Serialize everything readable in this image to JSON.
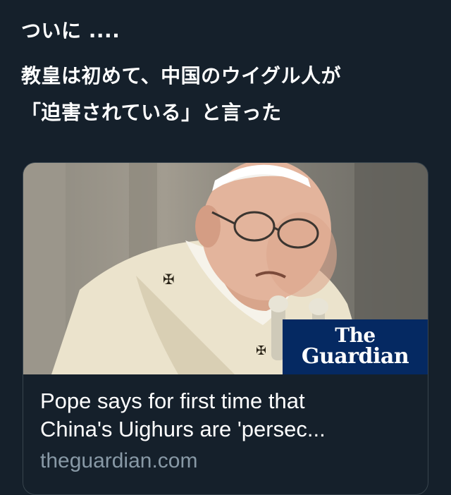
{
  "tweet": {
    "line1": "ついに ....",
    "line2": "教皇は初めて、中国のウイグル人が",
    "line3": "「迫害されている」と言った"
  },
  "card": {
    "image_brand_line1": "The",
    "image_brand_line2": "Guardian",
    "title": "Pope says for first time that\nChina's Uighurs are 'persec...",
    "domain": "theguardian.com"
  },
  "colors": {
    "background": "#15202b",
    "card_border": "#38444d",
    "domain_text": "#8899a6",
    "brand_box": "#052962"
  }
}
